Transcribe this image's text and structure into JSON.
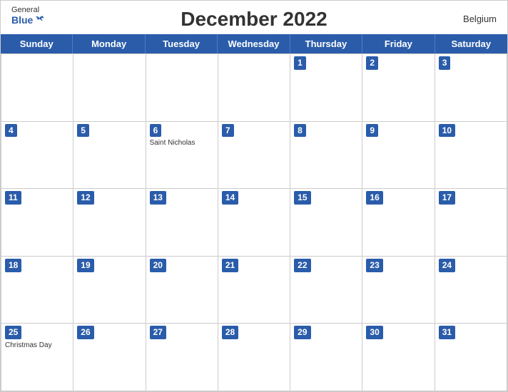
{
  "header": {
    "title": "December 2022",
    "country": "Belgium",
    "logo_general": "General",
    "logo_blue": "Blue"
  },
  "days_of_week": [
    "Sunday",
    "Monday",
    "Tuesday",
    "Wednesday",
    "Thursday",
    "Friday",
    "Saturday"
  ],
  "weeks": [
    [
      {
        "day": "",
        "holiday": ""
      },
      {
        "day": "",
        "holiday": ""
      },
      {
        "day": "",
        "holiday": ""
      },
      {
        "day": "",
        "holiday": ""
      },
      {
        "day": "1",
        "holiday": ""
      },
      {
        "day": "2",
        "holiday": ""
      },
      {
        "day": "3",
        "holiday": ""
      }
    ],
    [
      {
        "day": "4",
        "holiday": ""
      },
      {
        "day": "5",
        "holiday": ""
      },
      {
        "day": "6",
        "holiday": "Saint Nicholas"
      },
      {
        "day": "7",
        "holiday": ""
      },
      {
        "day": "8",
        "holiday": ""
      },
      {
        "day": "9",
        "holiday": ""
      },
      {
        "day": "10",
        "holiday": ""
      }
    ],
    [
      {
        "day": "11",
        "holiday": ""
      },
      {
        "day": "12",
        "holiday": ""
      },
      {
        "day": "13",
        "holiday": ""
      },
      {
        "day": "14",
        "holiday": ""
      },
      {
        "day": "15",
        "holiday": ""
      },
      {
        "day": "16",
        "holiday": ""
      },
      {
        "day": "17",
        "holiday": ""
      }
    ],
    [
      {
        "day": "18",
        "holiday": ""
      },
      {
        "day": "19",
        "holiday": ""
      },
      {
        "day": "20",
        "holiday": ""
      },
      {
        "day": "21",
        "holiday": ""
      },
      {
        "day": "22",
        "holiday": ""
      },
      {
        "day": "23",
        "holiday": ""
      },
      {
        "day": "24",
        "holiday": ""
      }
    ],
    [
      {
        "day": "25",
        "holiday": "Christmas Day"
      },
      {
        "day": "26",
        "holiday": ""
      },
      {
        "day": "27",
        "holiday": ""
      },
      {
        "day": "28",
        "holiday": ""
      },
      {
        "day": "29",
        "holiday": ""
      },
      {
        "day": "30",
        "holiday": ""
      },
      {
        "day": "31",
        "holiday": ""
      }
    ]
  ]
}
